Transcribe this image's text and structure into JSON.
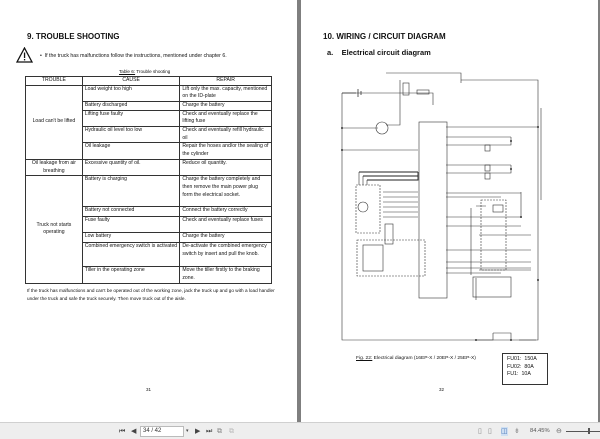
{
  "left_page": {
    "title": "9.  TROUBLE SHOOTING",
    "warning_icon": "warning-triangle-icon",
    "bullet": "If the truck has malfunctions follow the instructions, mentioned under chapter 6.",
    "caption_ref": "Table 6:",
    "caption_text": " Trouble shooting",
    "headers": [
      "TROUBLE",
      "CAUSE",
      "REPAIR"
    ],
    "groups": [
      {
        "trouble": "Load can't be lifted",
        "rows": [
          {
            "cause": "Load weight too high",
            "repair": "Lift only the max. capacity, mentioned on the ID-plate"
          },
          {
            "cause": "Battery discharged",
            "repair": "Charge the battery"
          },
          {
            "cause": "Lifting fuse faulty",
            "repair": "Check and eventually replace the lifting fuse"
          },
          {
            "cause": "Hydraulic oil level too low",
            "repair": "Check and eventually refill hydraulic oil"
          },
          {
            "cause": "Oil leakage",
            "repair": "Repair the hoses and/or the sealing of the cylinder"
          }
        ]
      },
      {
        "trouble": "Oil leakage from air breathing",
        "rows": [
          {
            "cause": "Excessive quantity of oil.",
            "repair": "Reduce oil quantity."
          }
        ]
      },
      {
        "trouble": "Truck not starts operating",
        "rows": [
          {
            "cause": "Battery is charging",
            "repair": "Charge the battery completely and then remove the main power plug form the electrical socket."
          },
          {
            "cause": "Battery not connected",
            "repair": "Connect the battery correctly"
          },
          {
            "cause": "Fuse faulty",
            "repair": "Check and eventually replace fuses"
          },
          {
            "cause": "Low battery",
            "repair": "Charge the battery"
          },
          {
            "cause": "Combined emergency switch is activated",
            "repair": "De-activate the combined emergency switch by insert and pull the knob."
          },
          {
            "cause": "Tiller in the operating zone",
            "repair": "Move the tiller firstly to the braking zone."
          }
        ]
      }
    ],
    "footer_text": "If the truck has malfunctions and can't be operated out of the working zone, jack the truck up and go with a load handler under the truck and safe the truck securely. Then move truck out of the aisle.",
    "page_number": "31"
  },
  "right_page": {
    "title": "10.   WIRING / CIRCUIT DIAGRAM",
    "subtitle_letter": "a.",
    "subtitle": "Electrical circuit diagram",
    "caption_ref": "Fig. 22:",
    "caption_text": " Electrical diagram (16EP-X / 20EP-X / 25EP-X)",
    "fuses": [
      {
        "name": "FU01:",
        "value": "150A"
      },
      {
        "name": "FU02:",
        "value": "80A"
      },
      {
        "name": "FU1:",
        "value": "10A"
      }
    ],
    "page_number": "32"
  },
  "toolbar": {
    "page_field": "34 / 42",
    "zoom": "84.45%"
  }
}
